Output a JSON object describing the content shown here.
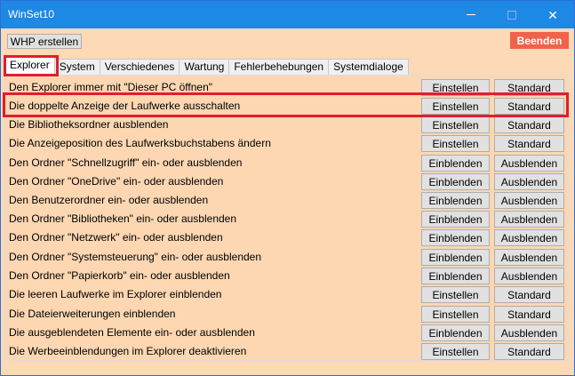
{
  "window": {
    "title": "WinSet10",
    "controls": {
      "minimize": "—",
      "maximize": "☐",
      "close": "✕"
    },
    "accent_color": "#1e88e5"
  },
  "toolbar": {
    "whp_label": "WHP erstellen",
    "beenden_label": "Beenden",
    "beenden_color": "#f0634a"
  },
  "tabs": [
    {
      "label": "Explorer",
      "active": true
    },
    {
      "label": "System"
    },
    {
      "label": "Verschiedenes"
    },
    {
      "label": "Wartung"
    },
    {
      "label": "Fehlerbehebungen"
    },
    {
      "label": "Systemdialoge"
    }
  ],
  "rows": [
    {
      "label": "Den Explorer immer mit \"Dieser PC öffnen\"",
      "btn1": "Einstellen",
      "btn2": "Standard"
    },
    {
      "label": "Die doppelte Anzeige der Laufwerke ausschalten",
      "btn1": "Einstellen",
      "btn2": "Standard"
    },
    {
      "label": "Die Bibliotheksordner ausblenden",
      "btn1": "Einstellen",
      "btn2": "Standard"
    },
    {
      "label": "Die Anzeigeposition des Laufwerksbuchstabens ändern",
      "btn1": "Einstellen",
      "btn2": "Standard"
    },
    {
      "label": "Den Ordner \"Schnellzugriff\" ein- oder ausblenden",
      "btn1": "Einblenden",
      "btn2": "Ausblenden"
    },
    {
      "label": "Den Ordner \"OneDrive\" ein- oder ausblenden",
      "btn1": "Einblenden",
      "btn2": "Ausblenden"
    },
    {
      "label": "Den Benutzerordner ein- oder ausblenden",
      "btn1": "Einblenden",
      "btn2": "Ausblenden"
    },
    {
      "label": "Den Ordner \"Bibliotheken\" ein- oder ausblenden",
      "btn1": "Einblenden",
      "btn2": "Ausblenden"
    },
    {
      "label": "Den Ordner \"Netzwerk\" ein- oder ausblenden",
      "btn1": "Einblenden",
      "btn2": "Ausblenden"
    },
    {
      "label": "Den Ordner \"Systemsteuerung\" ein- oder ausblenden",
      "btn1": "Einblenden",
      "btn2": "Ausblenden"
    },
    {
      "label": "Den Ordner \"Papierkorb\" ein- oder ausblenden",
      "btn1": "Einblenden",
      "btn2": "Ausblenden"
    },
    {
      "label": "Die leeren Laufwerke im Explorer einblenden",
      "btn1": "Einstellen",
      "btn2": "Standard"
    },
    {
      "label": "Die Dateierweiterungen einblenden",
      "btn1": "Einstellen",
      "btn2": "Standard"
    },
    {
      "label": "Die ausgeblendeten Elemente ein- oder ausblenden",
      "btn1": "Einblenden",
      "btn2": "Ausblenden"
    },
    {
      "label": "Die Werbeeinblendungen im Explorer deaktivieren",
      "btn1": "Einstellen",
      "btn2": "Standard"
    }
  ],
  "highlight_color": "#e11d2e"
}
